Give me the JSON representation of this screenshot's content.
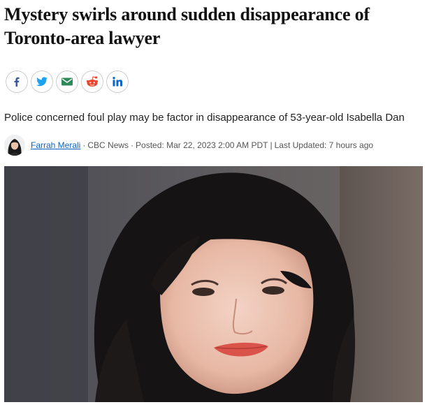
{
  "article": {
    "headline": "Mystery swirls around sudden disappearance of Toronto-area lawyer",
    "deck": "Police concerned foul play may be factor in disappearance of 53-year-old Isabella Dan"
  },
  "share": {
    "icons": [
      "facebook-icon",
      "twitter-icon",
      "email-icon",
      "reddit-icon",
      "linkedin-icon"
    ],
    "colors": {
      "facebook": "#3b5998",
      "twitter": "#1da1f2",
      "email": "#2e8b57",
      "reddit": "#e8452c",
      "linkedin": "#0a66c2"
    }
  },
  "byline": {
    "author": "Farrah Merali",
    "outlet": "CBC News",
    "posted": "Posted: Mar 22, 2023 2:00 AM PDT",
    "separator": "|",
    "updated": "Last Updated: 7 hours ago",
    "dot": "·"
  },
  "colors": {
    "link": "#0a63c4",
    "text": "#222222",
    "meta": "#555555"
  }
}
